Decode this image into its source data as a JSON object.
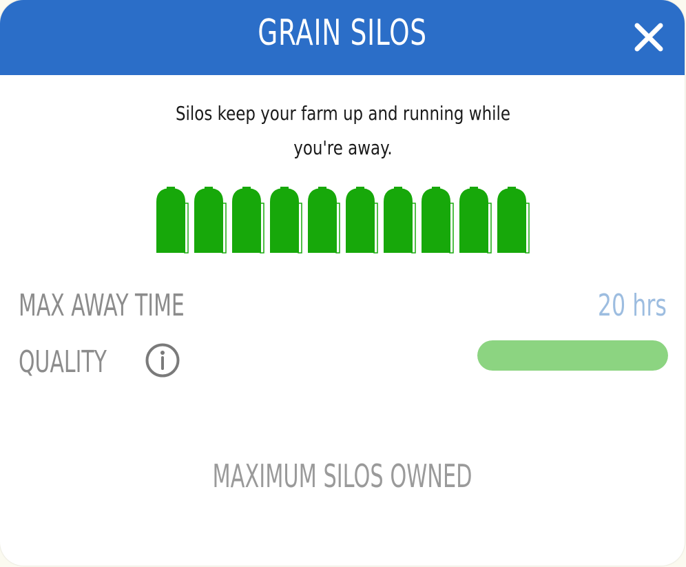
{
  "dialog": {
    "title": "GRAIN SILOS",
    "close_icon": "close-icon",
    "description": "Silos keep your farm up and running while you're away."
  },
  "silos": {
    "owned": 10,
    "max": 10,
    "icon": "silo-icon",
    "color": "#17a80a"
  },
  "stats": {
    "max_away_label": "MAX AWAY TIME",
    "max_away_value": "20 hrs",
    "quality_label": "QUALITY",
    "quality_info_icon": "info-icon",
    "quality_fraction": 1.0
  },
  "status": "MAXIMUM SILOS OWNED",
  "colors": {
    "header": "#2b6ec8",
    "quality_bar": "#8cd481",
    "value_text": "#9dbde0",
    "label_text": "#8c8c8c"
  }
}
